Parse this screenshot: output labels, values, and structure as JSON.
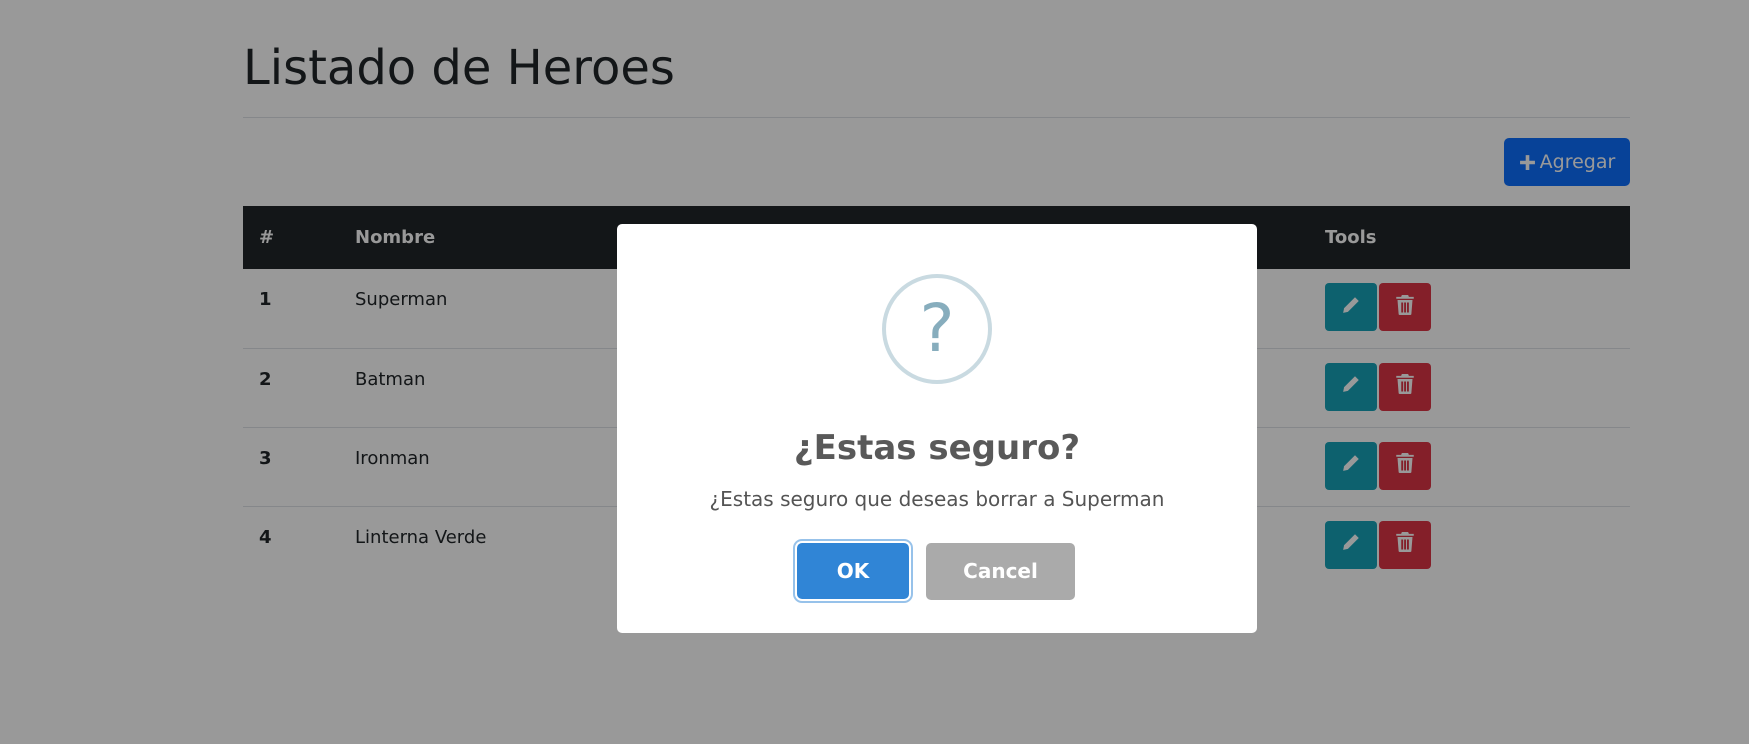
{
  "page": {
    "title": "Listado de Heroes",
    "add_button_label": "Agregar",
    "add_icon": "plus-icon"
  },
  "table": {
    "headers": [
      "#",
      "Nombre",
      "Tools"
    ],
    "rows": [
      {
        "num": "1",
        "name": "Superman"
      },
      {
        "num": "2",
        "name": "Batman"
      },
      {
        "num": "3",
        "name": "Ironman"
      },
      {
        "num": "4",
        "name": "Linterna Verde"
      }
    ],
    "edit_icon": "pencil-icon",
    "delete_icon": "trash-icon"
  },
  "dialog": {
    "icon": "question-icon",
    "icon_glyph": "?",
    "title": "¿Estas seguro?",
    "text": "¿Estas seguro que deseas borrar a Superman",
    "ok_label": "OK",
    "cancel_label": "Cancel"
  },
  "colors": {
    "primary": "#0d6efd",
    "table_header": "#212529",
    "edit": "#17a2b8",
    "delete": "#dc3545",
    "ok": "#3085d6",
    "cancel": "#aaaaaa"
  }
}
